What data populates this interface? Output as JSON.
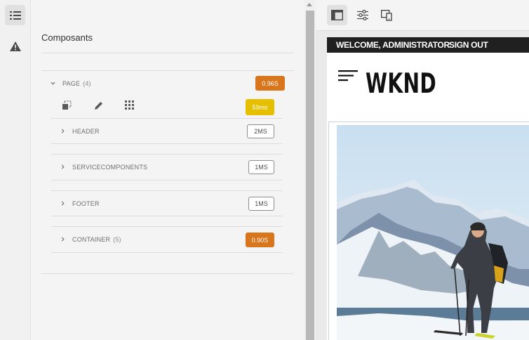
{
  "panel": {
    "title": "Composants",
    "tree": {
      "root": {
        "label": "PAGE",
        "count": "(4)",
        "timing": "0.96S",
        "timing_color": "#d9751a"
      },
      "root_inner_timing": {
        "value": "59ms",
        "color": "#e6c000"
      },
      "children": [
        {
          "label": "HEADER",
          "count": "",
          "timing": "2MS"
        },
        {
          "label": "SERVICECOMPONENTS",
          "count": "",
          "timing": "1MS"
        },
        {
          "label": "FOOTER",
          "count": "",
          "timing": "1MS"
        },
        {
          "label": "CONTAINER",
          "count": "(5)",
          "timing": "0.90S",
          "timing_color": "#d9751a"
        }
      ]
    }
  },
  "rail": {
    "icons": [
      "list-icon",
      "alert-triangle-icon"
    ]
  },
  "toolbar": {
    "icons": [
      "panel-layout-icon",
      "sliders-icon",
      "devices-icon"
    ]
  },
  "site": {
    "welcome": "WELCOME, ADMINISTRATOR",
    "signout": "SIGN OUT",
    "logo": "WKND"
  }
}
